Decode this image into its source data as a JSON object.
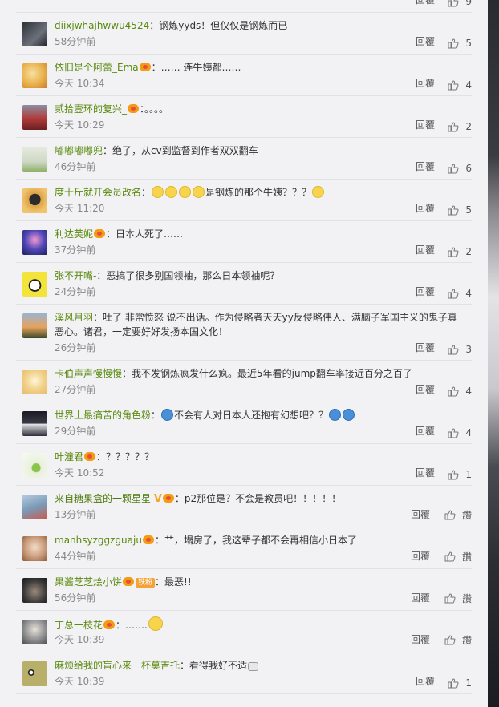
{
  "comments": [
    {
      "user": "",
      "text": "",
      "time": "",
      "reply": "回覆",
      "likes": "9",
      "avatar": "#d0d0d4"
    },
    {
      "user": "diixjwhajhwwu4524",
      "text": "钢炼yyds！但仅仅是钢炼而已",
      "time": "58分钟前",
      "reply": "回覆",
      "likes": "5",
      "avatar": "#3a3f48"
    },
    {
      "user": "依旧是个阿蕾_Ema",
      "text": "…… 连牛姨都……",
      "time": "今天 10:34",
      "reply": "回覆",
      "likes": "4",
      "avatar": "#e9c36a"
    },
    {
      "user": "贰拾壹环的复兴_",
      "text": "。。。。",
      "time": "今天 10:29",
      "reply": "回覆",
      "likes": "2",
      "avatar": "#b63b3b"
    },
    {
      "user": "嘟嘟嘟嘟兜",
      "text": "绝了，从cv到监督到作者双双翻车",
      "time": "46分钟前",
      "reply": "回覆",
      "likes": "6",
      "avatar": "#cfd8c4"
    },
    {
      "user": "度十斤就开会员改名",
      "text": "是钢炼的那个牛姨？？？",
      "time": "今天 11:20",
      "reply": "回覆",
      "likes": "5",
      "avatar": "#d8a24a"
    },
    {
      "user": "利达芙妮",
      "text": "日本人死了……",
      "time": "37分钟前",
      "reply": "回覆",
      "likes": "2",
      "avatar": "#3b3d9a"
    },
    {
      "user": "张不开嘴-",
      "text": "恶搞了很多别国领袖，那么日本领袖呢？",
      "time": "24分钟前",
      "reply": "回覆",
      "likes": "4",
      "avatar": "#f2e43a"
    },
    {
      "user": "溪风月羽",
      "text": "吐了 非常愤怒 说不出话。作为侵略者天天yy反侵略伟人、满脑子军国主义的鬼子真恶心。诸君，一定要好好发扬本国文化！",
      "time": "26分钟前",
      "reply": "回覆",
      "likes": "3",
      "avatar": "#6a8fb5"
    },
    {
      "user": "卡伯声声慢慢慢",
      "text": "我不发钢炼疯发什么疯。最近5年看的jump翻车率接近百分之百了",
      "time": "27分钟前",
      "reply": "回覆",
      "likes": "4",
      "avatar": "#f0d28a"
    },
    {
      "user": "世界上最痛苦的角色粉",
      "text": "不会有人对日本人还抱有幻想吧？？",
      "time": "29分钟前",
      "reply": "回覆",
      "likes": "4",
      "avatar": "#2e2f38"
    },
    {
      "user": "叶潼君",
      "text": "？？？？？",
      "time": "今天 10:52",
      "reply": "回覆",
      "likes": "1",
      "avatar": "#e8f0dc"
    },
    {
      "user": "来自糖果盒的一颗星星",
      "text": "p2那位是？不会是教员吧！！！！！",
      "time": "13分钟前",
      "reply": "回覆",
      "likes": "讚",
      "avatar": "#7a9ab8"
    },
    {
      "user": "manhsyzggzguaju",
      "text": "艹，塌房了，我这辈子都不会再相信小日本了",
      "time": "44分钟前",
      "reply": "回覆",
      "likes": "讚",
      "avatar": "#c99a7a"
    },
    {
      "user": "果酱芝芝烩小饼",
      "text": "最恶!!",
      "time": "56分钟前",
      "reply": "回覆",
      "likes": "讚",
      "avatar": "#3c3a3a",
      "tag": "铁粉"
    },
    {
      "user": "丁总一枝花",
      "text": "…….",
      "time": "今天 10:39",
      "reply": "回覆",
      "likes": "讚",
      "avatar": "#8d8e90"
    },
    {
      "user": "麻烦给我的盲心来一杯莫吉托",
      "text": "看得我好不适",
      "time": "今天 10:39",
      "reply": "回覆",
      "likes": "1",
      "avatar": "#6b6a3a"
    }
  ],
  "colors": {
    "username": "#5a8a0d",
    "panel": "#f2f2f5",
    "text": "#333333",
    "meta": "#888888"
  },
  "icons": {
    "like": "thumbs-up-icon",
    "badge": "fan-badge-icon",
    "emoji": "smile-emoji-icon"
  }
}
